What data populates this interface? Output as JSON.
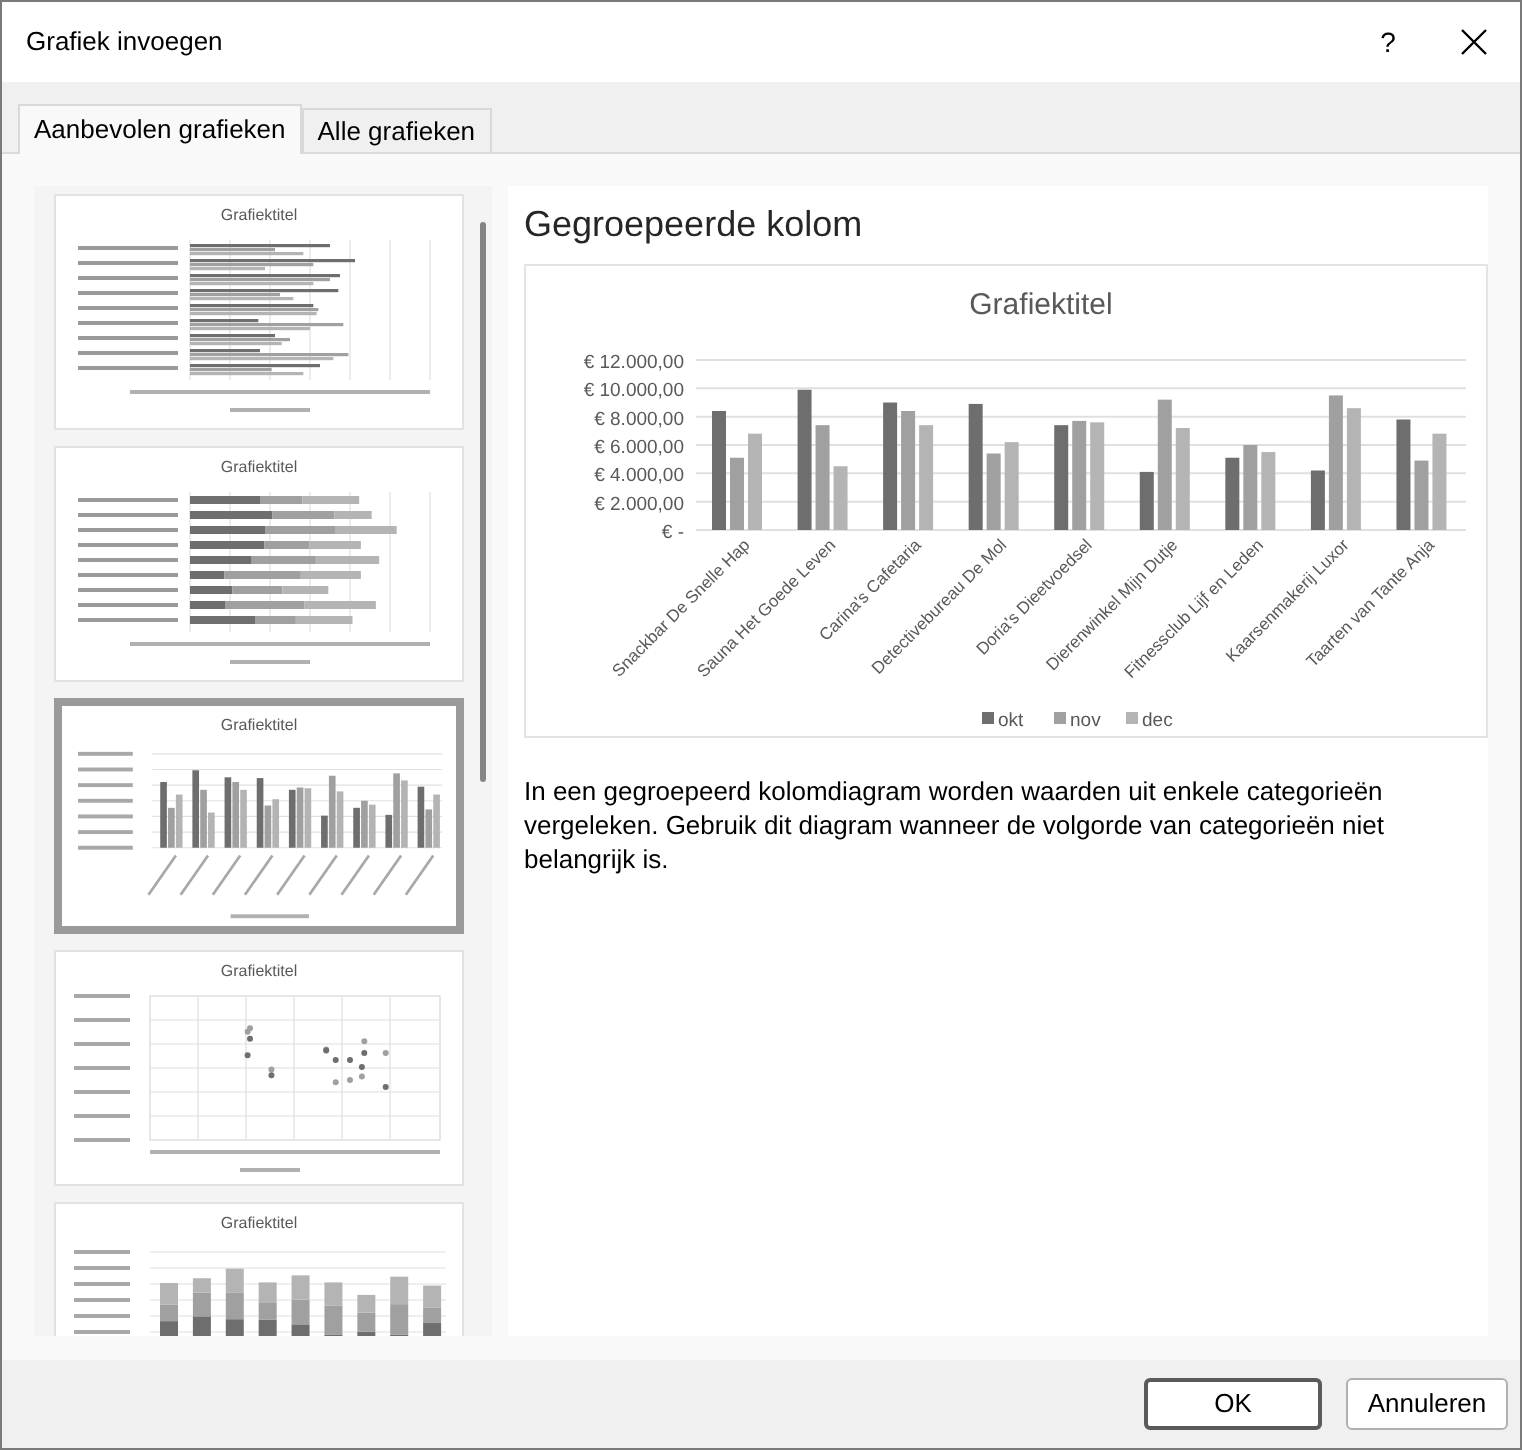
{
  "window": {
    "title": "Grafiek invoegen",
    "help": "?"
  },
  "tabs": [
    {
      "label": "Aanbevolen grafieken",
      "selected": true
    },
    {
      "label": "Alle grafieken",
      "selected": false
    }
  ],
  "thumbnails": [
    {
      "kind": "bar",
      "title": "Grafiektitel",
      "selected": false
    },
    {
      "kind": "stacked-bar",
      "title": "Grafiektitel",
      "selected": false
    },
    {
      "kind": "column",
      "title": "Grafiektitel",
      "selected": true
    },
    {
      "kind": "scatter",
      "title": "Grafiektitel",
      "selected": false
    },
    {
      "kind": "stacked-column",
      "title": "Grafiektitel",
      "selected": false
    }
  ],
  "preview": {
    "heading": "Gegroepeerde kolom",
    "chart_data": {
      "type": "bar",
      "title": "Grafiektitel",
      "categories": [
        "Snackbar De Snelle Hap",
        "Sauna Het Goede Leven",
        "Carina's Cafetaria",
        "Detectivebureau De Mol",
        "Doria's Dieetvoedsel",
        "Dierenwinkel Mijn Dutje",
        "Fitnessclub Lijf en Leden",
        "Kaarsenmakerij Luxor",
        "Taarten van Tante Anja"
      ],
      "series": [
        {
          "name": "okt",
          "color": "#6e6e6e",
          "values": [
            8400,
            9900,
            9000,
            8900,
            7400,
            4100,
            5100,
            4200,
            7800
          ]
        },
        {
          "name": "nov",
          "color": "#a0a0a0",
          "values": [
            5100,
            7400,
            8400,
            5400,
            7700,
            9200,
            6000,
            9500,
            4900
          ]
        },
        {
          "name": "dec",
          "color": "#b4b4b4",
          "values": [
            6800,
            4500,
            7400,
            6200,
            7600,
            7200,
            5500,
            8600,
            6800
          ]
        }
      ],
      "ylim": [
        0,
        12000
      ],
      "grid": true,
      "legend": true,
      "yticks": [
        {
          "value": 0,
          "label": "€ -"
        },
        {
          "value": 2000,
          "label": "€ 2.000,00"
        },
        {
          "value": 4000,
          "label": "€ 4.000,00"
        },
        {
          "value": 6000,
          "label": "€ 6.000,00"
        },
        {
          "value": 8000,
          "label": "€ 8.000,00"
        },
        {
          "value": 10000,
          "label": "€ 10.000,00"
        },
        {
          "value": 12000,
          "label": "€ 12.000,00"
        }
      ]
    },
    "description": "In een gegroepeerd kolomdiagram worden waarden uit enkele categorieën vergeleken. Gebruik dit diagram wanneer de volgorde van categorieën niet belangrijk is."
  },
  "buttons": [
    {
      "label": "OK",
      "kind": "primary"
    },
    {
      "label": "Annuleren",
      "kind": "secondary"
    }
  ]
}
